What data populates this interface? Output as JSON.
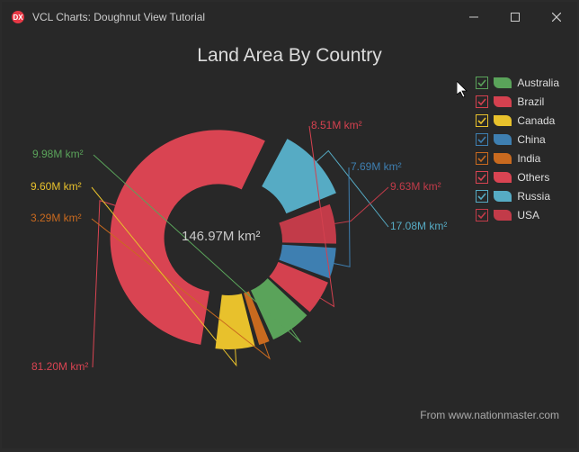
{
  "window": {
    "title": "VCL Charts: Doughnut View Tutorial"
  },
  "chart_data": {
    "type": "pie",
    "title": "Land Area By Country",
    "center_label": "146.97M km²",
    "categories": [
      "Others",
      "Russia",
      "USA",
      "China",
      "Brazil",
      "Australia",
      "India",
      "Canada"
    ],
    "values": [
      81.2,
      17.08,
      9.63,
      7.69,
      8.51,
      9.98,
      3.29,
      9.6
    ],
    "value_labels": [
      "81.20M km²",
      "17.08M km²",
      "9.63M km²",
      "7.69M km²",
      "8.51M km²",
      "9.98M km²",
      "3.29M km²",
      "9.60M km²"
    ],
    "colors": [
      "#d94452",
      "#56abc4",
      "#c23b49",
      "#3e7fb1",
      "#d4414f",
      "#5aa35a",
      "#c96a1f",
      "#e8c12c"
    ],
    "exploded": [
      true,
      true,
      false,
      false,
      false,
      false,
      false,
      false
    ],
    "legend_order": [
      "Australia",
      "Brazil",
      "Canada",
      "China",
      "India",
      "Others",
      "Russia",
      "USA"
    ]
  },
  "credit": "From www.nationmaster.com"
}
